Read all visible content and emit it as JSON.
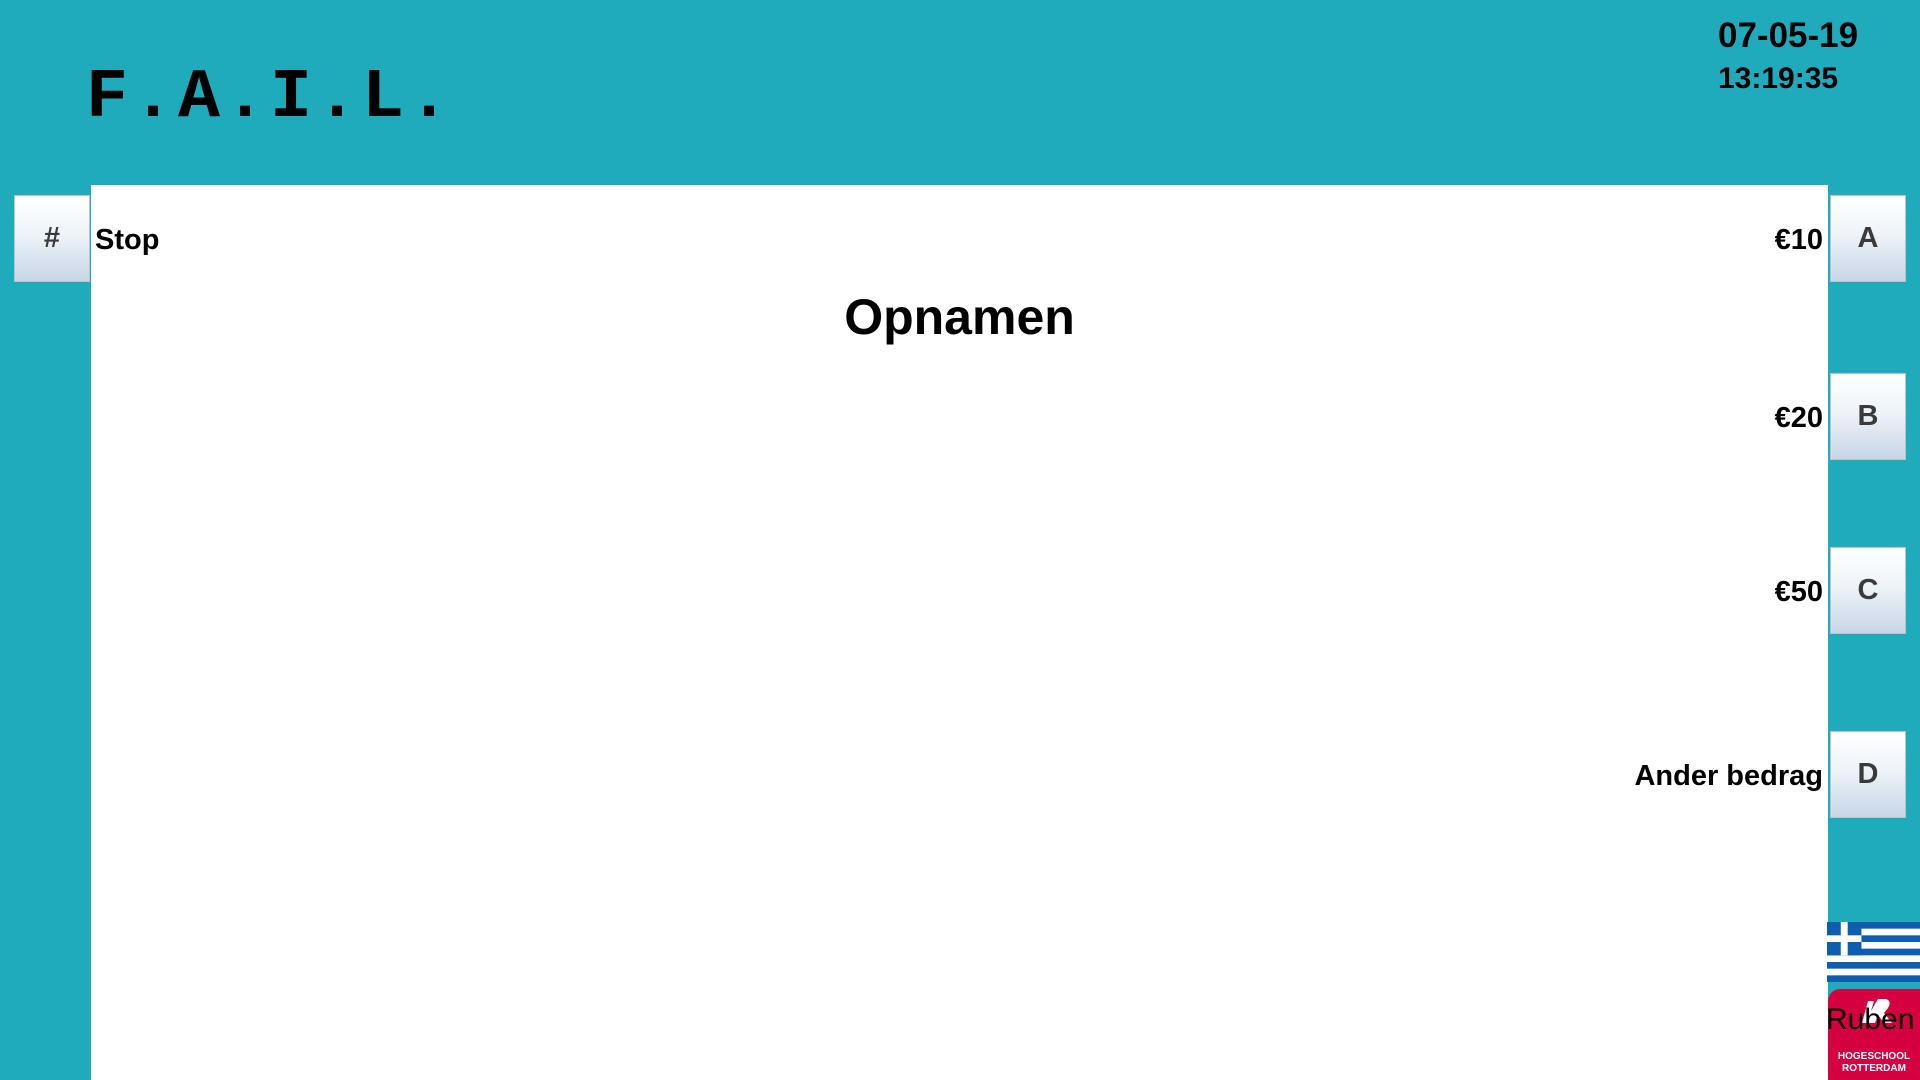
{
  "header": {
    "logo": "F.A.I.L.",
    "date": "07-05-19",
    "time": "13:19:35"
  },
  "screen": {
    "title": "Opnamen"
  },
  "left_keys": [
    {
      "key": "#",
      "label": "Stop"
    }
  ],
  "right_keys": [
    {
      "key": "A",
      "label": "€10"
    },
    {
      "key": "B",
      "label": "€20"
    },
    {
      "key": "C",
      "label": "€50"
    },
    {
      "key": "D",
      "label": "Ander bedrag"
    }
  ],
  "language": {
    "flag_icon": "greek-flag-icon"
  },
  "branding": {
    "institution_lines": [
      "HOGESCHOOL",
      "ROTTERDAM"
    ],
    "user": "Ruben"
  },
  "colors": {
    "background": "#20abbd",
    "panel": "#ffffff",
    "logo_red": "#d5003f",
    "flag_blue": "#0d5eaf"
  }
}
